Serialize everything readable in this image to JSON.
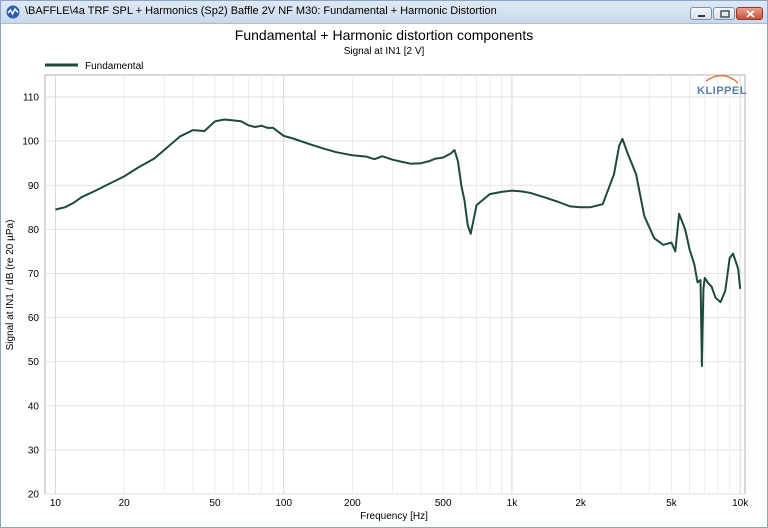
{
  "window": {
    "title": "\\BAFFLE\\4a TRF SPL + Harmonics (Sp2) Baffle 2V NF M30: Fundamental + Harmonic Distortion"
  },
  "chart_data": {
    "type": "line",
    "title": "Fundamental + Harmonic distortion components",
    "subtitle": "Signal at IN1 [2 V]",
    "xlabel": "Frequency [Hz]",
    "ylabel": "Signal at IN1 / dB (re 20 µPa)",
    "xscale": "log",
    "xlim": [
      9,
      10500
    ],
    "ylim": [
      20,
      115
    ],
    "x_ticks": [
      10,
      20,
      50,
      100,
      200,
      500,
      1000,
      2000,
      5000,
      10000
    ],
    "x_tick_labels": [
      "10",
      "20",
      "50",
      "100",
      "200",
      "500",
      "1k",
      "2k",
      "5k",
      "10k"
    ],
    "y_ticks": [
      20,
      30,
      40,
      50,
      60,
      70,
      80,
      90,
      100,
      110
    ],
    "y_tick_labels": [
      "20",
      "30",
      "40",
      "50",
      "60",
      "70",
      "80",
      "90",
      "100",
      "110"
    ],
    "grid": true,
    "legend_position": "top-left",
    "logo": "KLIPPEL",
    "series": [
      {
        "name": "Fundamental",
        "color": "#1d4a3e",
        "x": [
          10,
          11,
          12,
          13,
          15,
          17,
          20,
          23,
          27,
          30,
          35,
          40,
          45,
          50,
          55,
          60,
          65,
          70,
          75,
          80,
          85,
          90,
          100,
          110,
          130,
          150,
          170,
          200,
          230,
          250,
          270,
          300,
          330,
          360,
          400,
          430,
          460,
          500,
          540,
          560,
          580,
          600,
          620,
          640,
          660,
          700,
          800,
          900,
          1000,
          1100,
          1200,
          1400,
          1600,
          1800,
          2000,
          2200,
          2500,
          2800,
          2950,
          3050,
          3200,
          3500,
          3800,
          4200,
          4600,
          5000,
          5200,
          5400,
          5700,
          5800,
          6000,
          6300,
          6500,
          6700,
          6800,
          6900,
          7000,
          7200,
          7500,
          7800,
          8200,
          8600,
          9000,
          9300,
          9600,
          9800,
          10000
        ],
        "values": [
          84.5,
          85,
          86,
          87.3,
          88.8,
          90.2,
          92,
          94,
          96,
          98,
          101,
          102.5,
          102.3,
          104.5,
          104.9,
          104.7,
          104.5,
          103.6,
          103.2,
          103.5,
          103,
          103,
          101.2,
          100.6,
          99.3,
          98.3,
          97.5,
          96.8,
          96.5,
          95.9,
          96.6,
          95.8,
          95.3,
          94.9,
          95,
          95.4,
          96,
          96.3,
          97.2,
          98,
          95.5,
          90,
          86.5,
          81,
          79,
          85.5,
          88,
          88.5,
          88.8,
          88.6,
          88.3,
          87.2,
          86.2,
          85.2,
          85,
          85,
          85.7,
          92.5,
          99,
          100.5,
          97.5,
          92.5,
          83,
          78,
          76.5,
          77,
          75,
          83.5,
          80.5,
          79,
          75.5,
          72,
          68,
          68.5,
          49,
          66.5,
          69,
          68,
          67,
          64.5,
          63.5,
          66,
          73.5,
          74.5,
          72.5,
          71,
          66.5
        ]
      }
    ]
  }
}
